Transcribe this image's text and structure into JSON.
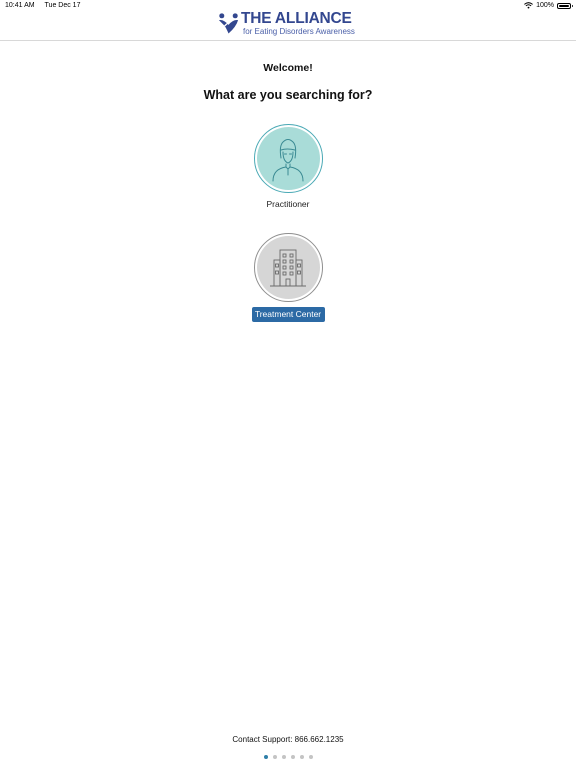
{
  "status_bar": {
    "time": "10:41 AM",
    "date": "Tue Dec 17",
    "battery": "100%",
    "icons": [
      "wifi-icon",
      "battery-icon"
    ]
  },
  "header": {
    "logo_title": "THE ALLIANCE",
    "logo_subtitle": "for Eating Disorders Awareness",
    "logo_icon": "heart-figure-logo",
    "brand_color": "#33478f"
  },
  "main": {
    "welcome": "Welcome!",
    "question": "What are you searching for?",
    "options": [
      {
        "label": "Practitioner",
        "icon": "person-icon",
        "circle_color": "#a9dcd8",
        "selected": false
      },
      {
        "label": "Treatment Center",
        "icon": "building-icon",
        "circle_color": "#d6d6d6",
        "selected": true
      }
    ],
    "selected_color": "#2c6aa5"
  },
  "footer": {
    "contact": "Contact Support: 866.662.1235",
    "page_count": 6,
    "current_page": 1,
    "dot_active_color": "#2f7fa8"
  }
}
